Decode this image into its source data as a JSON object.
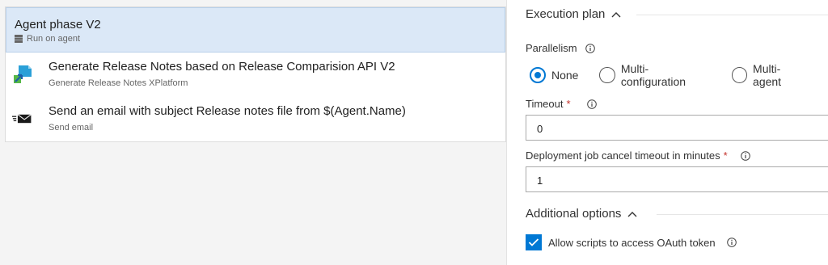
{
  "left_panel": {
    "phase": {
      "title": "Agent phase V2",
      "subtitle": "Run on agent",
      "icon": "server-icon"
    },
    "tasks": [
      {
        "title": "Generate Release Notes based on Release Comparision API V2",
        "subtitle": "Generate Release Notes XPlatform",
        "icon": "release-notes-icon"
      },
      {
        "title": "Send an email with subject Release notes file from $(Agent.Name)",
        "subtitle": "Send email",
        "icon": "email-icon"
      }
    ]
  },
  "right_panel": {
    "execution_plan": {
      "heading": "Execution plan",
      "parallelism_label": "Parallelism",
      "options": [
        {
          "label": "None",
          "selected": true
        },
        {
          "label": "Multi-configuration",
          "selected": false
        },
        {
          "label": "Multi-agent",
          "selected": false
        }
      ],
      "timeout_label": "Timeout",
      "timeout_value": "0",
      "cancel_timeout_label": "Deployment job cancel timeout in minutes",
      "cancel_timeout_value": "1",
      "required_mark": "*"
    },
    "additional_options": {
      "heading": "Additional options",
      "checkbox_label": "Allow scripts to access OAuth token",
      "checked": true
    }
  },
  "colors": {
    "accent": "#0078d4",
    "selected_row": "#dbe8f7",
    "required": "#c4312b"
  }
}
